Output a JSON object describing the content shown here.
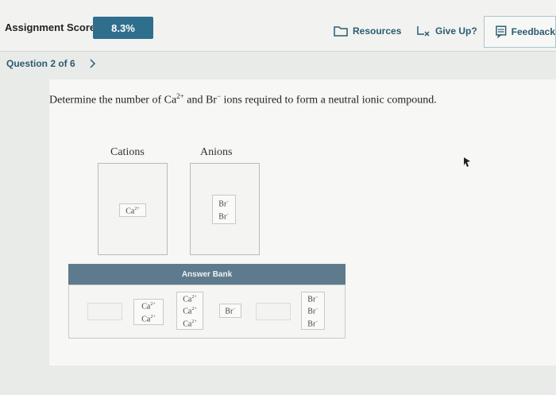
{
  "header": {
    "score_label": "Assignment Score:",
    "score_value": "8.3%",
    "resources_label": "Resources",
    "giveup_label": "Give Up?",
    "feedback_label": "Feedback"
  },
  "nav": {
    "question_label": "Question 2 of 6",
    "next_icon": "chevron-right-icon"
  },
  "question": {
    "text_before": "Determine the number of Ca",
    "ca_charge": "2+",
    "text_mid": " and Br",
    "br_charge": "−",
    "text_after": " ions required to form a neutral ionic compound."
  },
  "columns": {
    "cations_label": "Cations",
    "anions_label": "Anions",
    "cations_items": [
      {
        "symbol": "Ca",
        "charge": "2+"
      }
    ],
    "anions_items": [
      {
        "symbol": "Br",
        "charge": "−"
      },
      {
        "symbol": "Br",
        "charge": "−"
      }
    ]
  },
  "answer_bank": {
    "title": "Answer Bank",
    "tiles": [
      {
        "lines": [
          {
            "symbol": "Ca",
            "charge": "2+"
          },
          {
            "symbol": "Ca",
            "charge": "2+"
          }
        ]
      },
      {
        "lines": [
          {
            "symbol": "Ca",
            "charge": "2+"
          },
          {
            "symbol": "Ca",
            "charge": "2+"
          },
          {
            "symbol": "Ca",
            "charge": "2+"
          }
        ]
      },
      {
        "lines": [
          {
            "symbol": "Br",
            "charge": "−"
          }
        ]
      },
      {
        "lines": [
          {
            "symbol": "Br",
            "charge": "−"
          },
          {
            "symbol": "Br",
            "charge": "−"
          },
          {
            "symbol": "Br",
            "charge": "−"
          }
        ]
      }
    ]
  },
  "colors": {
    "accent": "#2f6f8d",
    "bank_header": "#5e7b8e"
  }
}
